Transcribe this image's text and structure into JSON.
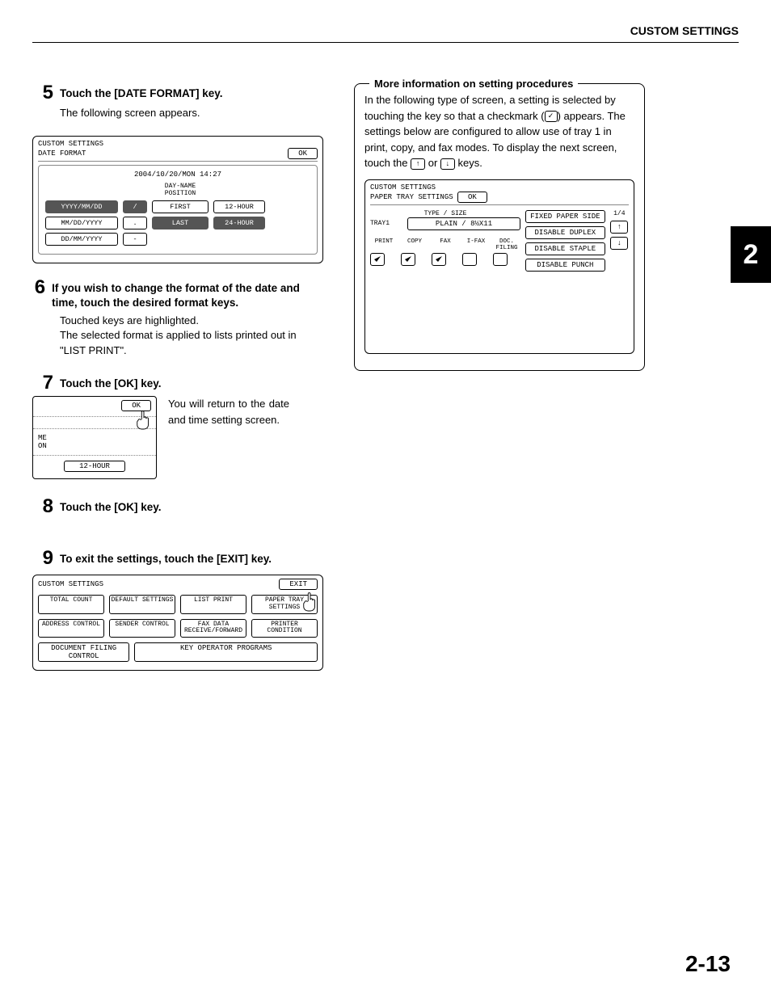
{
  "header": "CUSTOM SETTINGS",
  "page_number": "2-13",
  "side_tab": "2",
  "steps": {
    "s5": {
      "num": "5",
      "title": "Touch the [DATE FORMAT] key.",
      "body": "The following screen appears.",
      "panel": {
        "title": "CUSTOM SETTINGS",
        "subtitle": "DATE FORMAT",
        "ok": "OK",
        "datestr": "2004/10/20/MON 14:27",
        "col_label": "DAY-NAME POSITION",
        "c11": "YYYY/MM/DD",
        "c12": "/",
        "c13": "FIRST",
        "c14": "12-HOUR",
        "c21": "MM/DD/YYYY",
        "c22": ".",
        "c23": "LAST",
        "c24": "24-HOUR",
        "c31": "DD/MM/YYYY",
        "c32": "-"
      }
    },
    "s6": {
      "num": "6",
      "title": "If you wish to change the format of the date and time, touch the desired format keys.",
      "body": "Touched keys are highlighted.\nThe selected format is applied to lists printed out in \"LIST PRINT\"."
    },
    "s7": {
      "num": "7",
      "title": "Touch the [OK] key.",
      "text": "You will return to the date and time setting screen.",
      "panel": {
        "ok": "OK",
        "me": "ME",
        "on": "ON",
        "twelve": "12-HOUR"
      }
    },
    "s8": {
      "num": "8",
      "title": "Touch the [OK] key."
    },
    "s9": {
      "num": "9",
      "title": "To exit the settings, touch the [EXIT] key.",
      "panel": {
        "title": "CUSTOM SETTINGS",
        "exit": "EXIT",
        "b1": "TOTAL COUNT",
        "b2": "DEFAULT SETTINGS",
        "b3": "LIST PRINT",
        "b4": "PAPER TRAY SETTINGS",
        "b5": "ADDRESS CONTROL",
        "b6": "SENDER CONTROL",
        "b7": "FAX DATA RECEIVE/FORWARD",
        "b8": "PRINTER CONDITION",
        "b9": "DOCUMENT FILING CONTROL",
        "b10": "KEY OPERATOR PROGRAMS"
      }
    }
  },
  "info": {
    "legend": "More information on setting procedures",
    "text1": "In the following type of screen, a setting is selected by touching the key so that a checkmark (",
    "text2": ") appears. The settings below are configured to allow use of tray 1 in print, copy, and fax modes. To display the next screen, touch the ",
    "text3": " or ",
    "text4": " keys.",
    "arrow_up": "↑",
    "arrow_down": "↓",
    "check": "✓",
    "panel": {
      "title": "CUSTOM SETTINGS",
      "subtitle": "PAPER TRAY SETTINGS",
      "ok": "OK",
      "type_size": "TYPE / SIZE",
      "tray": "TRAY1",
      "plain": "PLAIN / 8½X11",
      "fixed": "FIXED PAPER SIDE",
      "dup": "DISABLE DUPLEX",
      "staple": "DISABLE STAPLE",
      "punch": "DISABLE PUNCH",
      "pagecount": "1/4",
      "modes": {
        "print": "PRINT",
        "copy": "COPY",
        "fax": "FAX",
        "ifax": "I-FAX",
        "doc": "DOC. FILING"
      }
    }
  }
}
